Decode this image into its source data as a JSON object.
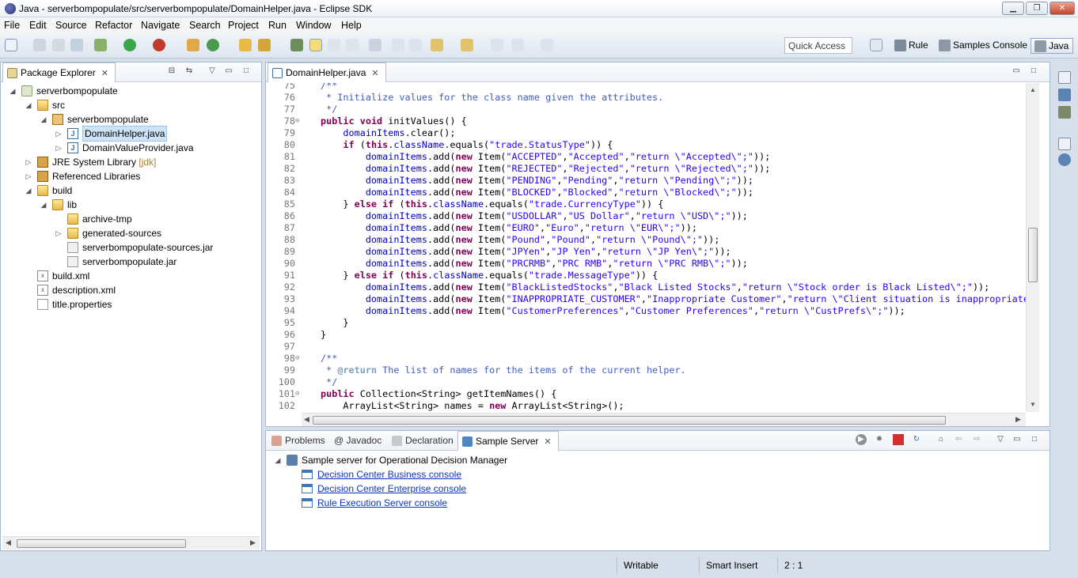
{
  "window": {
    "title": "Java - serverbompopulate/src/serverbompopulate/DomainHelper.java - Eclipse SDK",
    "minimize": "▁",
    "maximize": "❐",
    "close": "✕"
  },
  "menu": [
    "File",
    "Edit",
    "Source",
    "Refactor",
    "Navigate",
    "Search",
    "Project",
    "Run",
    "Window",
    "Help"
  ],
  "toolbar": {
    "quick_access_placeholder": "Quick Access",
    "perspectives": [
      "Rule",
      "Samples Console",
      "Java"
    ]
  },
  "package_explorer": {
    "title": "Package Explorer",
    "tree": [
      {
        "label": "serverbompopulate",
        "icon": "project-icon"
      },
      {
        "label": "src",
        "icon": "source-folder-icon"
      },
      {
        "label": "serverbompopulate",
        "icon": "package-icon"
      },
      {
        "label": "DomainHelper.java",
        "icon": "java-file-icon",
        "selected": true
      },
      {
        "label": "DomainValueProvider.java",
        "icon": "java-file-icon"
      },
      {
        "label": "JRE System Library",
        "decoration": "[jdk]",
        "icon": "library-icon"
      },
      {
        "label": "Referenced Libraries",
        "icon": "library-icon"
      },
      {
        "label": "build",
        "icon": "folder-icon"
      },
      {
        "label": "lib",
        "icon": "folder-icon"
      },
      {
        "label": "archive-tmp",
        "icon": "folder-icon"
      },
      {
        "label": "generated-sources",
        "icon": "folder-icon"
      },
      {
        "label": "serverbompopulate-sources.jar",
        "icon": "jar-icon"
      },
      {
        "label": "serverbompopulate.jar",
        "icon": "jar-icon"
      },
      {
        "label": "build.xml",
        "icon": "xml-file-icon"
      },
      {
        "label": "description.xml",
        "icon": "xml-file-icon"
      },
      {
        "label": "title.properties",
        "icon": "file-icon"
      }
    ]
  },
  "editor": {
    "tab": "DomainHelper.java",
    "lines": [
      {
        "n": "75",
        "fold": "",
        "code": "/**"
      },
      {
        "n": "76",
        "fold": "",
        "code": " * Initialize values for the class name given the attributes."
      },
      {
        "n": "77",
        "fold": "",
        "code": " */"
      },
      {
        "n": "78",
        "fold": "⊖",
        "code": "public void initValues() {"
      },
      {
        "n": "79",
        "fold": "",
        "code": "    domainItems.clear();"
      },
      {
        "n": "80",
        "fold": "",
        "code": "    if (this.className.equals(\"trade.StatusType\")) {"
      },
      {
        "n": "81",
        "fold": "",
        "code": "        domainItems.add(new Item(\"ACCEPTED\",\"Accepted\",\"return \\\"Accepted\\\";\"));"
      },
      {
        "n": "82",
        "fold": "",
        "code": "        domainItems.add(new Item(\"REJECTED\",\"Rejected\",\"return \\\"Rejected\\\";\"));"
      },
      {
        "n": "83",
        "fold": "",
        "code": "        domainItems.add(new Item(\"PENDING\",\"Pending\",\"return \\\"Pending\\\";\"));"
      },
      {
        "n": "84",
        "fold": "",
        "code": "        domainItems.add(new Item(\"BLOCKED\",\"Blocked\",\"return \\\"Blocked\\\";\"));"
      },
      {
        "n": "85",
        "fold": "",
        "code": "    } else if (this.className.equals(\"trade.CurrencyType\")) {"
      },
      {
        "n": "86",
        "fold": "",
        "code": "        domainItems.add(new Item(\"USDOLLAR\",\"US Dollar\",\"return \\\"USD\\\";\"));"
      },
      {
        "n": "87",
        "fold": "",
        "code": "        domainItems.add(new Item(\"EURO\",\"Euro\",\"return \\\"EUR\\\";\"));"
      },
      {
        "n": "88",
        "fold": "",
        "code": "        domainItems.add(new Item(\"Pound\",\"Pound\",\"return \\\"Pound\\\";\"));"
      },
      {
        "n": "89",
        "fold": "",
        "code": "        domainItems.add(new Item(\"JPYen\",\"JP Yen\",\"return \\\"JP Yen\\\";\"));"
      },
      {
        "n": "90",
        "fold": "",
        "code": "        domainItems.add(new Item(\"PRCRMB\",\"PRC RMB\",\"return \\\"PRC RMB\\\";\"));"
      },
      {
        "n": "91",
        "fold": "",
        "code": "    } else if (this.className.equals(\"trade.MessageType\")) {"
      },
      {
        "n": "92",
        "fold": "",
        "code": "        domainItems.add(new Item(\"BlackListedStocks\",\"Black Listed Stocks\",\"return \\\"Stock order is Black Listed\\\";\"));"
      },
      {
        "n": "93",
        "fold": "",
        "code": "        domainItems.add(new Item(\"INAPPROPRIATE_CUSTOMER\",\"Inappropriate Customer\",\"return \\\"Client situation is inappropriate,"
      },
      {
        "n": "94",
        "fold": "",
        "code": "        domainItems.add(new Item(\"CustomerPreferences\",\"Customer Preferences\",\"return \\\"CustPrefs\\\";\"));"
      },
      {
        "n": "95",
        "fold": "",
        "code": "    }"
      },
      {
        "n": "96",
        "fold": "",
        "code": "}"
      },
      {
        "n": "97",
        "fold": "",
        "code": ""
      },
      {
        "n": "98",
        "fold": "⊖",
        "code": "/**"
      },
      {
        "n": "99",
        "fold": "",
        "code": " * @return The list of names for the items of the current helper."
      },
      {
        "n": "100",
        "fold": "",
        "code": " */"
      },
      {
        "n": "101",
        "fold": "⊖",
        "code": "public Collection<String> getItemNames() {"
      },
      {
        "n": "102",
        "fold": "",
        "code": "    ArrayList<String> names = new ArrayList<String>();"
      }
    ]
  },
  "bottom_panel": {
    "tabs": [
      "Problems",
      "@ Javadoc",
      "Declaration",
      "Sample Server"
    ],
    "server_label": "Sample server for Operational Decision Manager",
    "links": [
      "Decision Center Business console",
      "Decision Center Enterprise console",
      "Rule Execution Server console"
    ]
  },
  "statusbar": {
    "writable": "Writable",
    "insert_mode": "Smart Insert",
    "position": "2 : 1"
  },
  "colors": {
    "keyword": "#7f0055",
    "string": "#2a00ff",
    "comment": "#3f5fbf",
    "field": "#0000c0",
    "link": "#0b35c4"
  }
}
